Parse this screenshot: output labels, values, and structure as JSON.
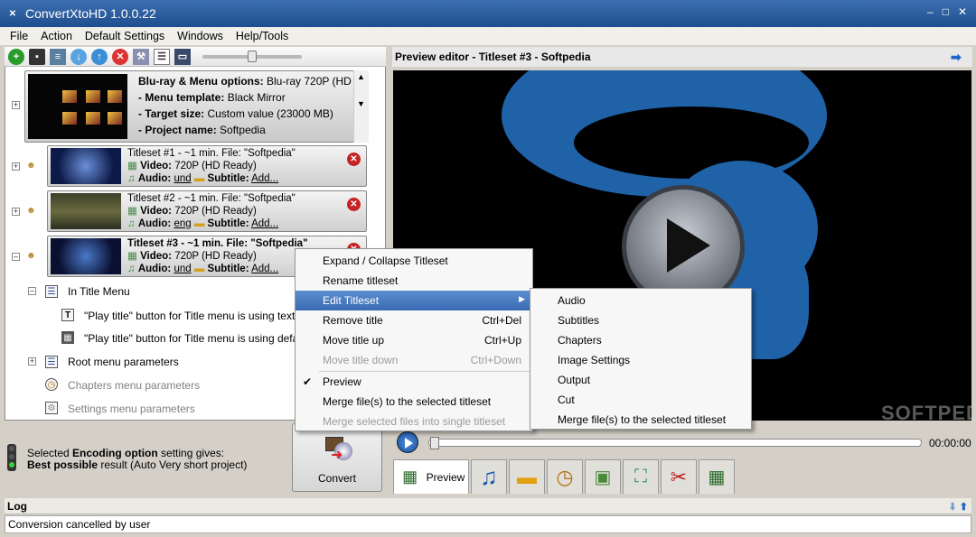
{
  "app": {
    "title": "ConvertXtoHD 1.0.0.22"
  },
  "menu": [
    "File",
    "Action",
    "Default Settings",
    "Windows",
    "Help/Tools"
  ],
  "project": {
    "line1_label": "Blu-ray & Menu options:",
    "line1_value": "Blu-ray 720P (HD ...",
    "line2_label": "- Menu template:",
    "line2_value": "Black Mirror",
    "line3_label": "- Target size:",
    "line3_value": "Custom value (23000 MB)",
    "line4_label": "- Project name:",
    "line4_value": "Softpedia"
  },
  "titlesets": [
    {
      "title": "Titleset #1 - ~1 min. File: \"Softpedia\"",
      "video_label": "Video:",
      "video": "720P (HD Ready)",
      "audio_label": "Audio:",
      "audio": "und",
      "subtitle_label": "Subtitle:",
      "subtitle": "Add..."
    },
    {
      "title": "Titleset #2 - ~1 min. File: \"Softpedia\"",
      "video_label": "Video:",
      "video": "720P (HD Ready)",
      "audio_label": "Audio:",
      "audio": "eng",
      "subtitle_label": "Subtitle:",
      "subtitle": "Add..."
    },
    {
      "title": "Titleset #3 - ~1 min. File: \"Softpedia\"",
      "video_label": "Video:",
      "video": "720P (HD Ready)",
      "audio_label": "Audio:",
      "audio": "und",
      "subtitle_label": "Subtitle:",
      "subtitle": "Add..."
    }
  ],
  "tree": {
    "in_title_menu": "In Title Menu",
    "play_text": "\"Play title\" button for Title menu is using text: \"S",
    "play_default": "\"Play title\" button for Title menu is using default",
    "root_menu": "Root menu parameters",
    "chapters_menu": "Chapters menu parameters",
    "settings_menu": "Settings menu parameters"
  },
  "encoding": {
    "line1_pre": "Selected ",
    "line1_bold": "Encoding option",
    "line1_post": " setting gives:",
    "line2_bold": "Best possible",
    "line2_post": " result (Auto Very short project)"
  },
  "convert_label": "Convert",
  "preview": {
    "header": "Preview editor - Titleset #3 - Softpedia",
    "watermark": "SOFTPEDIA",
    "time": "00:00:00",
    "tab_preview": "Preview"
  },
  "context_menu": [
    {
      "label": "Expand / Collapse Titleset",
      "shortcut": ""
    },
    {
      "label": "Rename titleset",
      "shortcut": ""
    },
    {
      "label": "Edit Titleset",
      "shortcut": ""
    },
    {
      "label": "Remove title",
      "shortcut": "Ctrl+Del"
    },
    {
      "label": "Move title up",
      "shortcut": "Ctrl+Up"
    },
    {
      "label": "Move title down",
      "shortcut": "Ctrl+Down"
    },
    {
      "label": "Preview",
      "shortcut": ""
    },
    {
      "label": "Merge file(s) to the selected titleset",
      "shortcut": ""
    },
    {
      "label": "Merge selected files into single titleset",
      "shortcut": ""
    }
  ],
  "submenu": [
    "Audio",
    "Subtitles",
    "Chapters",
    "Image Settings",
    "Output",
    "Cut",
    "Merge file(s) to the selected titleset"
  ],
  "log": {
    "header": "Log",
    "status": "Conversion cancelled by user"
  },
  "colors": {
    "titlebar": "#2a5a9c",
    "highlight": "#3a6ab3",
    "preview_blue": "#1f62a8"
  }
}
